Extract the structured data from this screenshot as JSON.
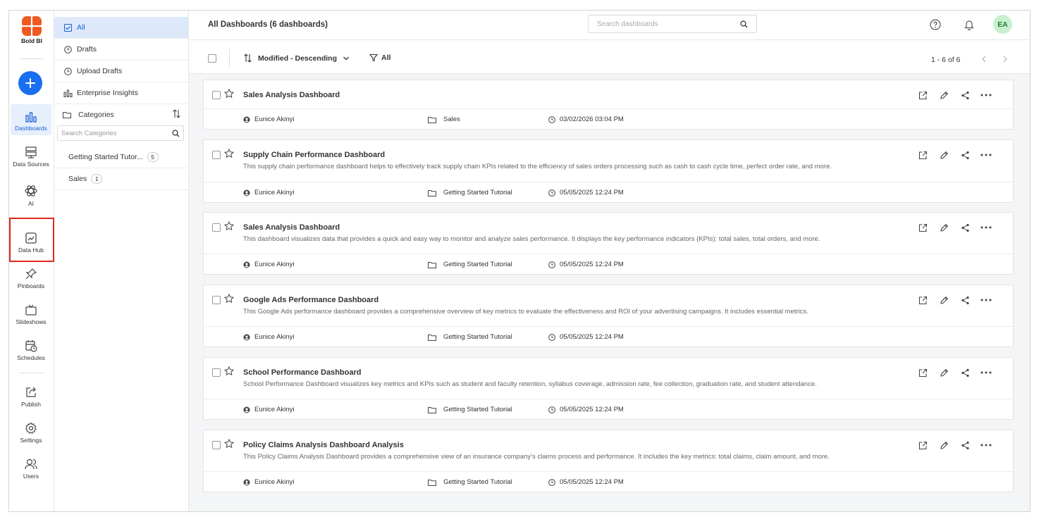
{
  "app": {
    "logo_text": "Bold BI"
  },
  "rail": {
    "items": [
      {
        "label": "Dashboards",
        "icon": "bar-chart-icon",
        "active": true
      },
      {
        "label": "Data Sources",
        "icon": "server-icon"
      },
      {
        "label": "AI",
        "icon": "atom-icon"
      },
      {
        "label": "Data Hub",
        "icon": "image-chart-icon"
      },
      {
        "label": "Pinboards",
        "icon": "pin-icon"
      },
      {
        "label": "Slideshows",
        "icon": "tv-icon"
      },
      {
        "label": "Schedules",
        "icon": "calendar-clock-icon"
      },
      {
        "label": "Publish",
        "icon": "publish-icon"
      },
      {
        "label": "Settings",
        "icon": "gear-icon"
      },
      {
        "label": "Users",
        "icon": "users-icon"
      }
    ]
  },
  "sidebar": {
    "items": [
      {
        "label": "All"
      },
      {
        "label": "Drafts"
      },
      {
        "label": "Upload Drafts"
      },
      {
        "label": "Enterprise Insights"
      }
    ],
    "categories_label": "Categories",
    "search_placeholder": "Search Categories",
    "categories": [
      {
        "label": "Getting Started Tutor...",
        "count": "5"
      },
      {
        "label": "Sales",
        "count": "1"
      }
    ]
  },
  "header": {
    "title": "All Dashboards (6 dashboards)",
    "search_placeholder": "Search dashboards",
    "avatar": "EA"
  },
  "toolbar": {
    "sort_label": "Modified - Descending",
    "filter_label": "All",
    "pager": "1 - 6 of 6"
  },
  "dashboards": [
    {
      "title": "Sales Analysis Dashboard",
      "description": "",
      "owner": "Eunice Akinyi",
      "category": "Sales",
      "modified": "03/02/2026 03:04 PM"
    },
    {
      "title": "Supply Chain Performance Dashboard",
      "description": "This supply chain performance dashboard helps to effectively track supply chain KPIs related to the efficiency of sales orders processing such as cash to cash cycle time, perfect order rate, and more.",
      "owner": "Eunice Akinyi",
      "category": "Getting Started Tutorial",
      "modified": "05/05/2025 12:24 PM"
    },
    {
      "title": "Sales Analysis Dashboard",
      "description": "This dashboard visualizes data that provides a quick and easy way to monitor and analyze sales performance. It displays the key performance indicators (KPIs): total sales, total orders, and more.",
      "owner": "Eunice Akinyi",
      "category": "Getting Started Tutorial",
      "modified": "05/05/2025 12:24 PM"
    },
    {
      "title": "Google Ads Performance Dashboard",
      "description": "This Google Ads performance dashboard provides a comprehensive overview of key metrics to evaluate the effectiveness and ROI of your advertising campaigns. It includes essential metrics.",
      "owner": "Eunice Akinyi",
      "category": "Getting Started Tutorial",
      "modified": "05/05/2025 12:24 PM"
    },
    {
      "title": "School Performance Dashboard",
      "description": "School Performance Dashboard visualizes key metrics and KPIs such as student and faculty retention, syllabus coverage, admission rate, fee collection, graduation rate, and student attendance.",
      "owner": "Eunice Akinyi",
      "category": "Getting Started Tutorial",
      "modified": "05/05/2025 12:24 PM"
    },
    {
      "title": "Policy Claims Analysis Dashboard Analysis",
      "description": "This Policy Claims Analysis Dashboard provides a comprehensive view of an insurance company's claims process and performance. It includes the key metrics: total claims, claim amount, and more.",
      "owner": "Eunice Akinyi",
      "category": "Getting Started Tutorial",
      "modified": "05/05/2025 12:24 PM"
    }
  ]
}
